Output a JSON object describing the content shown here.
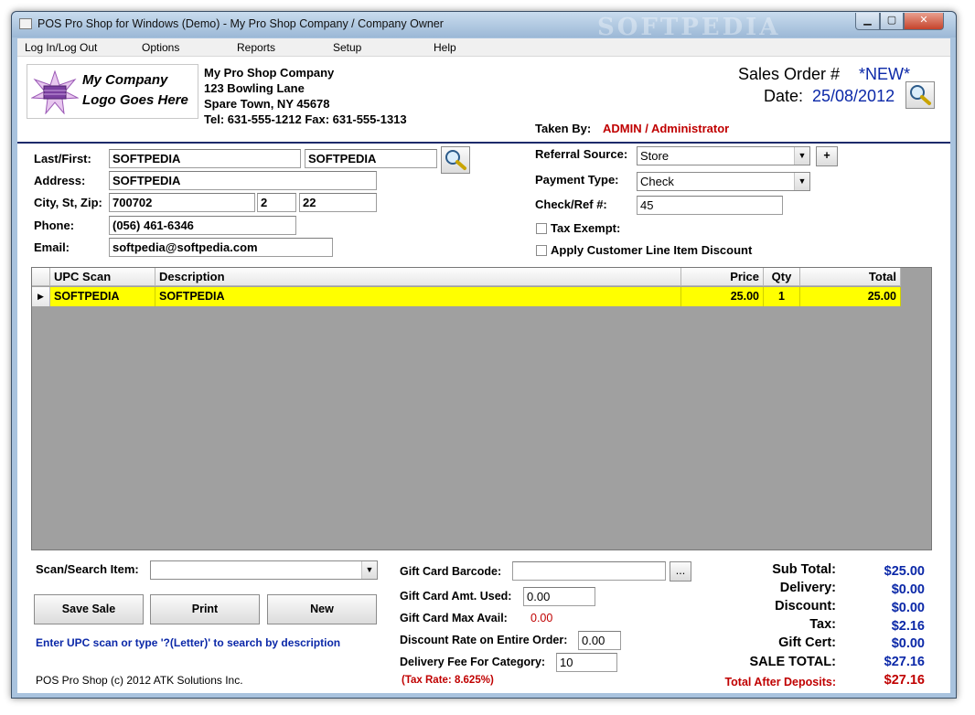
{
  "window": {
    "title": "POS Pro Shop for Windows (Demo)  - My Pro Shop Company / Company Owner",
    "watermark": "SOFTPEDIA",
    "min_glyph": "▁",
    "max_glyph": "▢",
    "close_glyph": "✕"
  },
  "menu": [
    "Log In/Log Out",
    "Options",
    "Reports",
    "Setup",
    "Help"
  ],
  "logo": {
    "line1": "My Company",
    "line2": "Logo Goes Here"
  },
  "company": {
    "name": "My Pro Shop Company",
    "street": "123 Bowling Lane",
    "city": "Spare Town, NY 45678",
    "phones": "Tel: 631-555-1212  Fax: 631-555-1313"
  },
  "order": {
    "label": "Sales Order #",
    "number": "*NEW*",
    "date_label": "Date:",
    "date": "25/08/2012",
    "taken_by_label": "Taken By:",
    "taken_by": "ADMIN / Administrator"
  },
  "customer": {
    "lastfirst_label": "Last/First:",
    "last": "SOFTPEDIA",
    "first": "SOFTPEDIA",
    "address_label": "Address:",
    "address": "SOFTPEDIA",
    "csz_label": "City, St, Zip:",
    "city": "700702",
    "state": "2",
    "zip": "22",
    "phone_label": "Phone:",
    "phone": "(056) 461-6346",
    "email_label": "Email:",
    "email": "softpedia@softpedia.com"
  },
  "payment": {
    "referral_label": "Referral Source:",
    "referral": "Store",
    "add_label": "+",
    "type_label": "Payment Type:",
    "type": "Check",
    "ref_label": "Check/Ref #:",
    "ref": "45",
    "tax_exempt_label": "Tax Exempt:",
    "line_discount_label": "Apply Customer Line Item Discount"
  },
  "grid": {
    "columns": [
      "UPC Scan",
      "Description",
      "Price",
      "Qty",
      "Total"
    ],
    "rows": [
      {
        "upc": "SOFTPEDIA",
        "description": "SOFTPEDIA",
        "price": "25.00",
        "qty": "1",
        "total": "25.00"
      }
    ]
  },
  "scan": {
    "label": "Scan/Search Item:",
    "value": "",
    "hint": "Enter UPC scan or type '?(Letter)' to search by description"
  },
  "buttons": {
    "save": "Save Sale",
    "print": "Print",
    "new": "New",
    "browse": "..."
  },
  "gift": {
    "barcode_label": "Gift Card Barcode:",
    "amt_used_label": "Gift Card Amt. Used:",
    "amt_used": "0.00",
    "max_avail_label": "Gift Card Max Avail:",
    "max_avail": "0.00",
    "discount_rate_label": "Discount Rate on Entire Order:",
    "discount_rate": "0.00",
    "delivery_fee_label": "Delivery Fee For Category:",
    "delivery_fee": "10",
    "tax_rate": "(Tax Rate: 8.625%)"
  },
  "totals": {
    "subtotal_label": "Sub Total:",
    "subtotal": "$25.00",
    "delivery_label": "Delivery:",
    "delivery": "$0.00",
    "discount_label": "Discount:",
    "discount": "$0.00",
    "tax_label": "Tax:",
    "tax": "$2.16",
    "giftcert_label": "Gift Cert:",
    "giftcert": "$0.00",
    "sale_total_label": "SALE TOTAL:",
    "sale_total": "$27.16",
    "after_deposits_label": "Total After Deposits:",
    "after_deposits": "$27.16"
  },
  "footer": {
    "copyright": "POS Pro Shop (c) 2012 ATK Solutions Inc."
  },
  "colors": {
    "accent_blue": "#0b28a8",
    "alert_red": "#c00000",
    "row_highlight": "#ffff00"
  },
  "icons": [
    "magnifier-icon",
    "row-pointer-icon",
    "dropdown-arrow-icon",
    "checkbox-icon",
    "logo-star-icon"
  ]
}
